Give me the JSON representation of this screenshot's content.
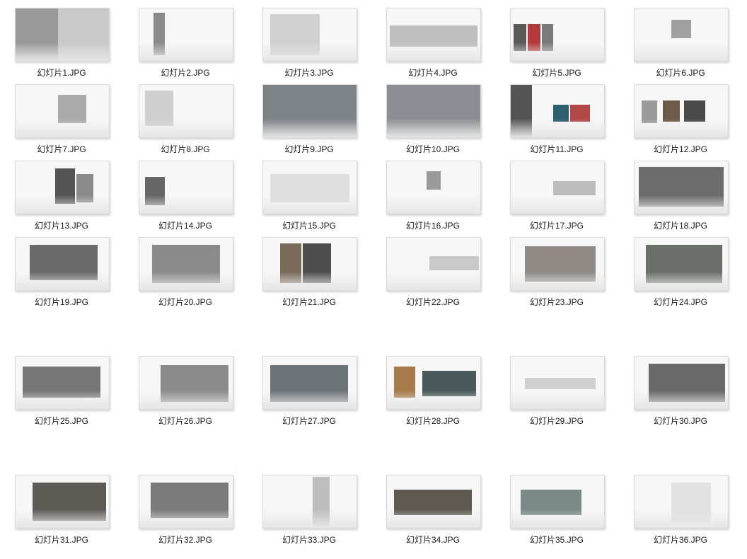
{
  "files": [
    {
      "label": "幻灯片1.JPG"
    },
    {
      "label": "幻灯片2.JPG"
    },
    {
      "label": "幻灯片3.JPG"
    },
    {
      "label": "幻灯片4.JPG"
    },
    {
      "label": "幻灯片5.JPG"
    },
    {
      "label": "幻灯片6.JPG"
    },
    {
      "label": "幻灯片7.JPG"
    },
    {
      "label": "幻灯片8.JPG"
    },
    {
      "label": "幻灯片9.JPG"
    },
    {
      "label": "幻灯片10.JPG"
    },
    {
      "label": "幻灯片11.JPG"
    },
    {
      "label": "幻灯片12.JPG"
    },
    {
      "label": "幻灯片13.JPG"
    },
    {
      "label": "幻灯片14.JPG"
    },
    {
      "label": "幻灯片15.JPG"
    },
    {
      "label": "幻灯片16.JPG"
    },
    {
      "label": "幻灯片17.JPG"
    },
    {
      "label": "幻灯片18.JPG"
    },
    {
      "label": "幻灯片19.JPG"
    },
    {
      "label": "幻灯片20.JPG"
    },
    {
      "label": "幻灯片21.JPG"
    },
    {
      "label": "幻灯片22.JPG"
    },
    {
      "label": "幻灯片23.JPG"
    },
    {
      "label": "幻灯片24.JPG"
    },
    {
      "label": "幻灯片25.JPG"
    },
    {
      "label": "幻灯片26.JPG"
    },
    {
      "label": "幻灯片27.JPG"
    },
    {
      "label": "幻灯片28.JPG"
    },
    {
      "label": "幻灯片29.JPG"
    },
    {
      "label": "幻灯片30.JPG"
    },
    {
      "label": "幻灯片31.JPG"
    },
    {
      "label": "幻灯片32.JPG"
    },
    {
      "label": "幻灯片33.JPG"
    },
    {
      "label": "幻灯片34.JPG"
    },
    {
      "label": "幻灯片35.JPG"
    },
    {
      "label": "幻灯片36.JPG"
    }
  ]
}
